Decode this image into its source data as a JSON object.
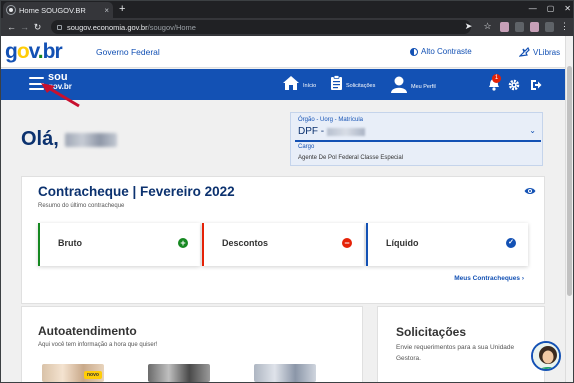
{
  "browser": {
    "tab_title": "Home SOUGOV.BR",
    "tab_close": "×",
    "new_tab": "+",
    "url_host": "sougov.economia.gov.br",
    "url_path": "/sougov/Home",
    "min": "—",
    "max": "▢",
    "close": "✕"
  },
  "header": {
    "gov_logo": {
      "g": "g",
      "o": "o",
      "v": "v",
      "dot": ".",
      "br": "br"
    },
    "federal": "Governo Federal",
    "alto_contraste": "Alto Contraste",
    "vlibras": "VLibras"
  },
  "nav": {
    "brand_top": "sou",
    "brand_bottom": "gov.br",
    "inicio": "Início",
    "solicitacoes": "Solicitações",
    "meu_perfil": "Meu Perfil",
    "notifications_count": "1"
  },
  "greeting": "Olá,",
  "org": {
    "label": "Órgão - Uorg - Matrícula",
    "value": "DPF -",
    "cargo_label": "Cargo",
    "cargo_value": "Agente De Pol Federal Classe Especial"
  },
  "contracheque": {
    "title": "Contracheque | Fevereiro 2022",
    "subtitle": "Resumo do último contracheque",
    "cards": [
      {
        "label": "Bruto",
        "icon": "+",
        "color": "#168821"
      },
      {
        "label": "Descontos",
        "icon": "−",
        "color": "#e52207"
      },
      {
        "label": "Líquido",
        "icon": "✓",
        "color": "#1351b4"
      }
    ],
    "link": "Meus Contracheques",
    "link_chevron": "›"
  },
  "autoatendimento": {
    "title": "Autoatendimento",
    "subtitle": "Aqui você tem informação a hora que quiser!",
    "badge": "novo"
  },
  "solicitacoes": {
    "title": "Solicitações",
    "subtitle": "Envie requerimentos para a sua Unidade Gestora."
  }
}
